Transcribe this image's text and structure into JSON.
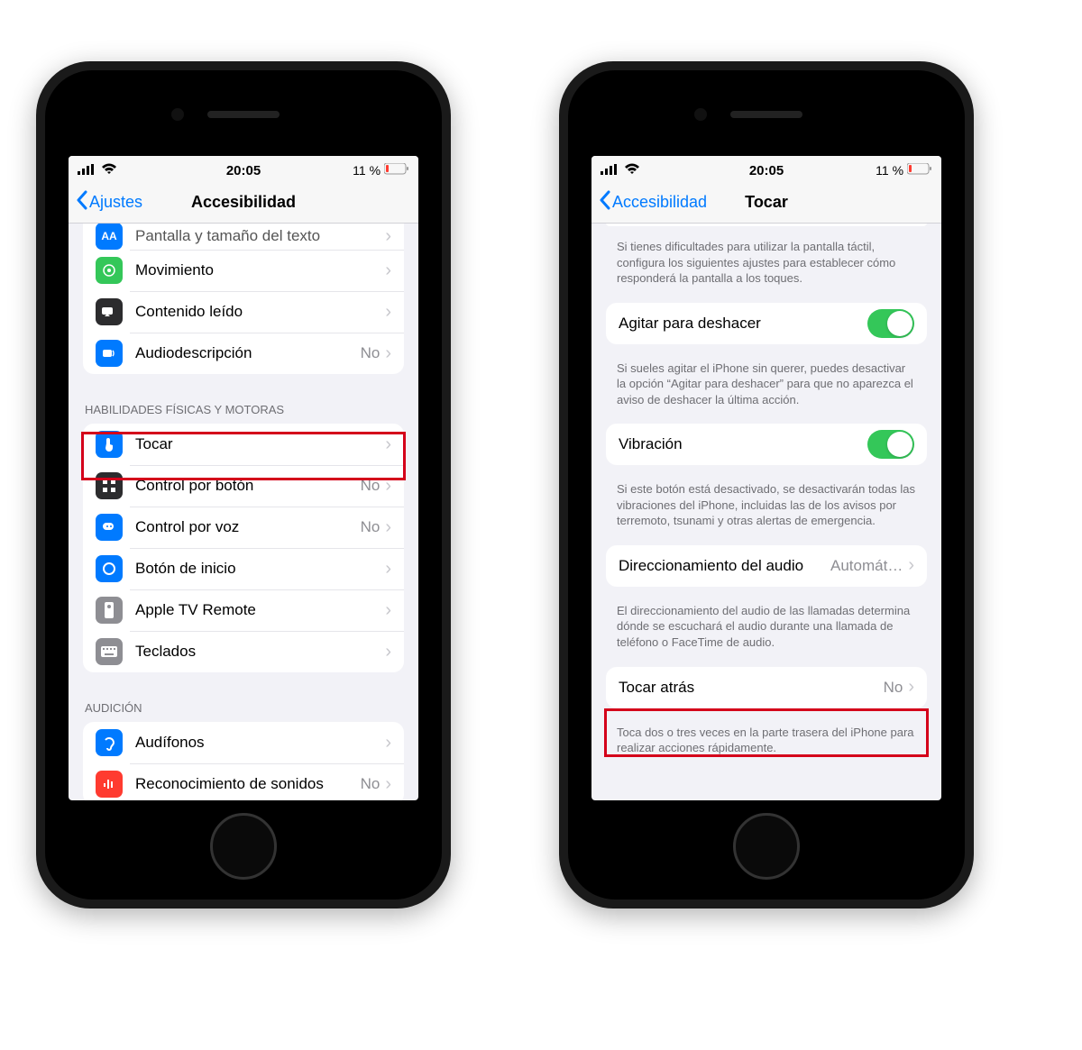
{
  "status": {
    "time": "20:05",
    "battery": "11 %"
  },
  "leftPhone": {
    "back": "Ajustes",
    "title": "Accesibilidad",
    "group1": [
      {
        "label": "Pantalla y tamaño del texto",
        "icon": "AA",
        "bg": "#007aff"
      },
      {
        "label": "Movimiento",
        "icon": "motion",
        "bg": "#34c759"
      },
      {
        "label": "Contenido leído",
        "icon": "speech",
        "bg": "#2c2c2e"
      },
      {
        "label": "Audiodescripción",
        "value": "No",
        "icon": "desc",
        "bg": "#007aff"
      }
    ],
    "section2": "HABILIDADES FÍSICAS Y MOTORAS",
    "group2": [
      {
        "label": "Tocar",
        "icon": "touch",
        "bg": "#007aff"
      },
      {
        "label": "Control por botón",
        "value": "No",
        "icon": "switch",
        "bg": "#2c2c2e"
      },
      {
        "label": "Control por voz",
        "value": "No",
        "icon": "voice",
        "bg": "#007aff"
      },
      {
        "label": "Botón de inicio",
        "icon": "home",
        "bg": "#007aff"
      },
      {
        "label": "Apple TV Remote",
        "icon": "remote",
        "bg": "#8e8e93"
      },
      {
        "label": "Teclados",
        "icon": "keyboard",
        "bg": "#8e8e93"
      }
    ],
    "section3": "AUDICIÓN",
    "group3": [
      {
        "label": "Audífonos",
        "icon": "ear",
        "bg": "#007aff"
      },
      {
        "label": "Reconocimiento de sonidos",
        "value": "No",
        "icon": "sound",
        "bg": "#ff3b30"
      }
    ]
  },
  "rightPhone": {
    "back": "Accesibilidad",
    "title": "Tocar",
    "intro": "Si tienes dificultades para utilizar la pantalla táctil, configura los siguientes ajustes para establecer cómo responderá la pantalla a los toques.",
    "shake": {
      "label": "Agitar para deshacer"
    },
    "shakeFooter": "Si sueles agitar el iPhone sin querer, puedes desactivar la opción “Agitar para deshacer” para que no aparezca el aviso de deshacer la última acción.",
    "vib": {
      "label": "Vibración"
    },
    "vibFooter": "Si este botón está desactivado, se desactivarán todas las vibraciones del iPhone, incluidas las de los avisos por terremoto, tsunami y otras alertas de emergencia.",
    "audio": {
      "label": "Direccionamiento del audio",
      "value": "Automát…"
    },
    "audioFooter": "El direccionamiento del audio de las llamadas determina dónde se escuchará el audio durante una llamada de teléfono o FaceTime de audio.",
    "backtap": {
      "label": "Tocar atrás",
      "value": "No"
    },
    "backtapFooter": "Toca dos o tres veces en la parte trasera del iPhone para realizar acciones rápidamente."
  }
}
